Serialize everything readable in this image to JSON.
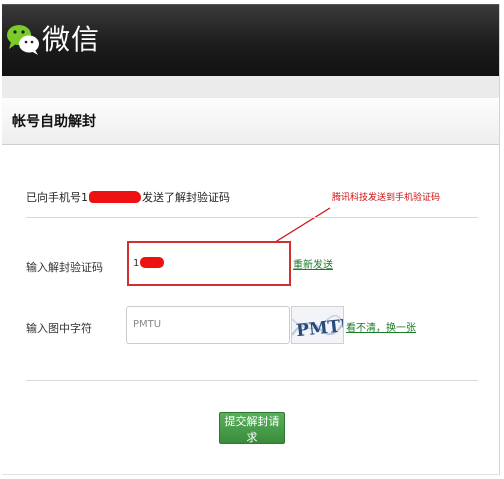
{
  "header": {
    "app_title": "微信",
    "logo_icon": "wechat-logo-icon"
  },
  "page": {
    "title": "帐号自助解封"
  },
  "form": {
    "sent_msg_prefix": "已向手机号1",
    "sent_msg_suffix": "发送了解封验证码",
    "annotation": "腾讯科技发送到手机验证码",
    "code_label": "输入解封验证码",
    "code_value_prefix": "1",
    "resend_link": "重新发送",
    "captcha_label": "输入图中字符",
    "captcha_value": "PMTU",
    "captcha_image_text": "PMTU",
    "captcha_refresh_link": "看不清，换一张",
    "submit_label": "提交解封请求"
  },
  "colors": {
    "header_bg": "#1c1c1c",
    "link_green": "#1c7a29",
    "button_green": "#45a047",
    "annotation_red": "#cc1111",
    "redaction_red": "#ee1111"
  }
}
